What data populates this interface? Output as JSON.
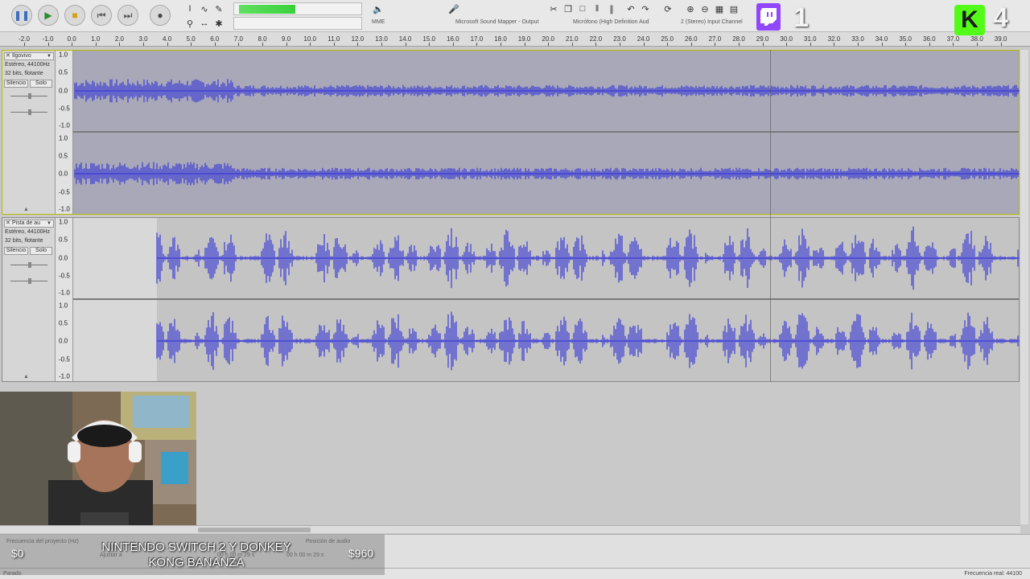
{
  "toolbar": {
    "input_device": "Microsoft Sound Mapper - Output",
    "mic_device": "Micrófono (High Definition Aud",
    "channels": "2 (Stereo) Input Channel",
    "host": "MME"
  },
  "ruler": {
    "ticks": [
      "-2.0",
      "-1.0",
      "0.0",
      "1.0",
      "2.0",
      "3.0",
      "4.0",
      "5.0",
      "6.0",
      "7.0",
      "8.0",
      "9.0",
      "10.0",
      "11.0",
      "12.0",
      "13.0",
      "14.0",
      "15.0",
      "16.0",
      "17.0",
      "18.0",
      "19.0",
      "20.0",
      "21.0",
      "22.0",
      "23.0",
      "24.0",
      "25.0",
      "26.0",
      "27.0",
      "28.0",
      "29.0",
      "30.0",
      "31.0",
      "32.0",
      "33.0",
      "34.0",
      "35.0",
      "36.0",
      "37.0",
      "38.0",
      "39.0"
    ]
  },
  "tracks": [
    {
      "name": "Ilgovivo",
      "info1": "Estéreo, 44100Hz",
      "info2": "32 bits, flotante",
      "mute": "Silencio",
      "solo": "Solo",
      "scale_top": [
        "1.0",
        "0.5",
        "0.0",
        "-0.5",
        "-1.0"
      ],
      "scale_bottom": [
        "1.0",
        "0.5",
        "0.0",
        "-0.5",
        "-1.0"
      ]
    },
    {
      "name": "Pista de au",
      "info1": "Estéreo, 44100Hz",
      "info2": "32 bits, flotante",
      "mute": "Silencio",
      "solo": "Solo",
      "scale_top": [
        "1.0",
        "0.5",
        "0.0",
        "-0.5",
        "-1.0"
      ],
      "scale_bottom": [
        "1.0",
        "0.5",
        "0.0",
        "-0.5",
        "-1.0"
      ]
    }
  ],
  "selection_bar": {
    "project_rate_label": "Frecuencia del proyecto (Hz)",
    "snap_label": "Ajustar a",
    "audio_position_label": "Posición de audio",
    "time1": "00 h 00 m 29 s",
    "time2": "00 h 00 m 29 s"
  },
  "status": {
    "left": "Parado.",
    "right": "Frecuencia real: 44100"
  },
  "overlay": {
    "title": "NINTENDO SWITCH 2 Y DONKEY KONG BANANZA",
    "left_amount": "$0",
    "right_amount": "$960",
    "twitch_count": "1",
    "kick_count": "4",
    "kick_letter": "K"
  },
  "colors": {
    "waveform": "#3b3bd6",
    "track1_bg": "#a8a8b8",
    "track2_bg": "#c4c4c4",
    "twitch": "#9146ff",
    "kick": "#53fc18"
  }
}
